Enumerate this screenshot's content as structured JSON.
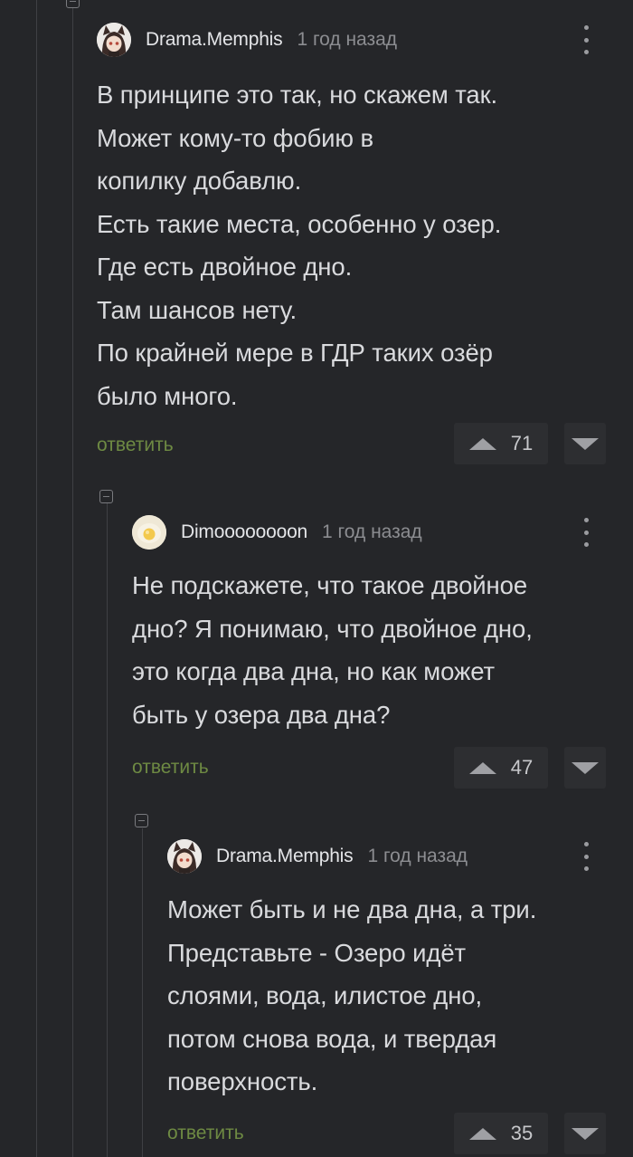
{
  "comments": [
    {
      "author": "Drama.Memphis",
      "time": "1 год назад",
      "avatar_icon": "anime-girl-avatar-icon",
      "text": "В принципе это так, но скажем так.\nМожет кому-то фобию в\nкопилку добавлю.\nЕсть такие места, особенно у озер.\nГде есть двойное дно.\nТам шансов нету.\nПо крайней мере в ГДР таких озёр\nбыло много.",
      "reply_label": "ответить",
      "score": "71"
    },
    {
      "author": "Dimoooooooon",
      "time": "1 год назад",
      "avatar_icon": "egg-avatar-icon",
      "text": "Не подскажете, что такое двойное\nдно? Я понимаю, что двойное дно,\nэто когда два дна, но как может\nбыть у озера два дна?",
      "reply_label": "ответить",
      "score": "47"
    },
    {
      "author": "Drama.Memphis",
      "time": "1 год назад",
      "avatar_icon": "anime-girl-avatar-icon",
      "text": "Может быть и не два дна, а три.\nПредставьте - Озеро идёт\nслоями, вода, илистое дно,\nпотом снова вода, и твердая\nповерхность.",
      "reply_label": "ответить",
      "score": "35"
    }
  ],
  "colors": {
    "background": "#252629",
    "reply_link": "#6e8a43",
    "thread_line": "#3f4044"
  }
}
